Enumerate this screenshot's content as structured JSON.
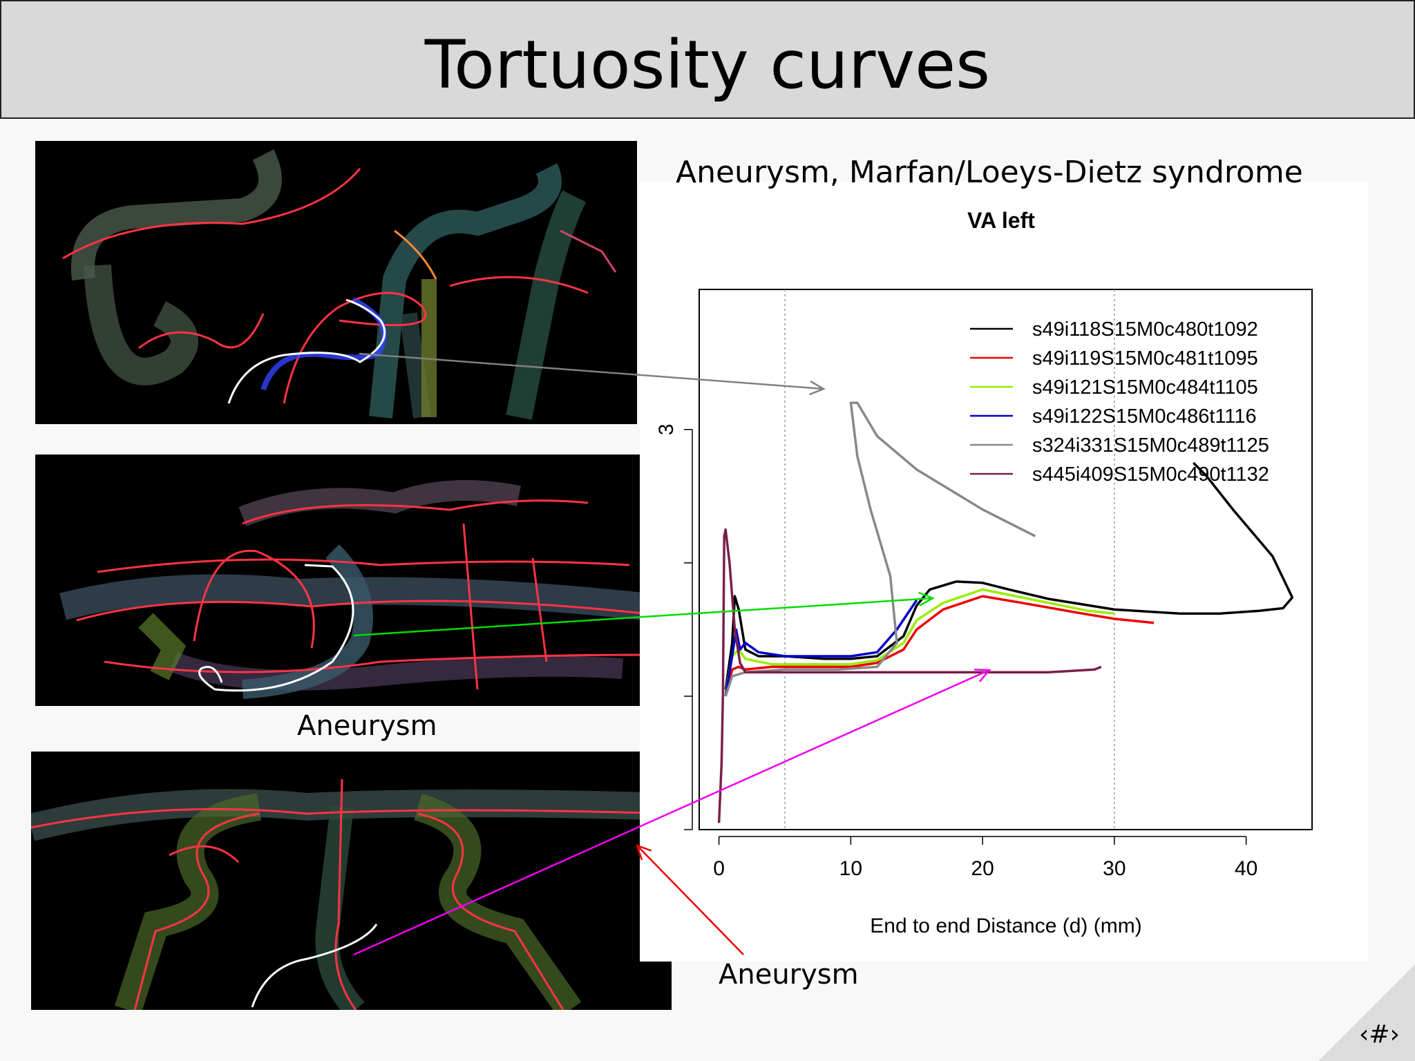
{
  "slide": {
    "title": "Tortuosity curves",
    "subtitle": "Aneurysm, Marfan/Loeys-Dietz syndrome",
    "label_aneurysm_mid": "Aneurysm",
    "label_aneurysm_bottom": "Aneurysm",
    "slide_number": "‹#›"
  },
  "colors": {
    "title_bar": "#d9d9d9",
    "arrow_gray": "#808080",
    "arrow_green": "#00dd00",
    "arrow_magenta": "#ee00ee",
    "arrow_red": "#ee0000"
  },
  "images": [
    {
      "name": "vessel-image-top",
      "content": "vessel-tree-rendering"
    },
    {
      "name": "vessel-image-middle",
      "content": "vessel-tree-rendering"
    },
    {
      "name": "vessel-image-bottom",
      "content": "vessel-tree-rendering"
    }
  ],
  "chart_data": {
    "type": "line",
    "title": "VA left",
    "xlabel": "End to end Distance (d) (mm)",
    "ylabel": "",
    "xlim": [
      -1.5,
      45
    ],
    "ylim": [
      0.0,
      4.05
    ],
    "x_ticks": [
      0,
      10,
      20,
      30,
      40
    ],
    "x_tick_labels": [
      "0",
      "10",
      "20",
      "30",
      "40"
    ],
    "y_ticks": [
      0,
      1,
      2,
      3
    ],
    "y_tick_labels": [
      "",
      "",
      "",
      "3"
    ],
    "vertical_grid": [
      5,
      30
    ],
    "legend_position": "top-right",
    "series": [
      {
        "name": "s49i118S15M0c480t1092",
        "color": "#000000",
        "points": [
          [
            0.5,
            1.05
          ],
          [
            1.0,
            1.4
          ],
          [
            1.2,
            1.75
          ],
          [
            1.5,
            1.65
          ],
          [
            2,
            1.35
          ],
          [
            3,
            1.3
          ],
          [
            5,
            1.3
          ],
          [
            8,
            1.28
          ],
          [
            10,
            1.28
          ],
          [
            12,
            1.3
          ],
          [
            14,
            1.45
          ],
          [
            15,
            1.68
          ],
          [
            16,
            1.8
          ],
          [
            18,
            1.86
          ],
          [
            20,
            1.85
          ],
          [
            22,
            1.8
          ],
          [
            25,
            1.73
          ],
          [
            30,
            1.65
          ],
          [
            35,
            1.62
          ],
          [
            38,
            1.62
          ],
          [
            41,
            1.64
          ],
          [
            42.8,
            1.66
          ],
          [
            43.5,
            1.74
          ],
          [
            42,
            2.05
          ],
          [
            39,
            2.4
          ],
          [
            37,
            2.65
          ],
          [
            36,
            2.75
          ]
        ]
      },
      {
        "name": "s49i119S15M0c481t1095",
        "color": "#ee0000",
        "points": [
          [
            0.5,
            1.0
          ],
          [
            1.0,
            1.2
          ],
          [
            1.5,
            1.22
          ],
          [
            2,
            1.2
          ],
          [
            4,
            1.22
          ],
          [
            8,
            1.22
          ],
          [
            10,
            1.22
          ],
          [
            12,
            1.25
          ],
          [
            14,
            1.35
          ],
          [
            15,
            1.5
          ],
          [
            17,
            1.65
          ],
          [
            20,
            1.75
          ],
          [
            23,
            1.7
          ],
          [
            27,
            1.63
          ],
          [
            30,
            1.58
          ],
          [
            33,
            1.55
          ]
        ]
      },
      {
        "name": "s49i121S15M0c484t1105",
        "color": "#99ee00",
        "points": [
          [
            0.5,
            1.02
          ],
          [
            1.0,
            1.3
          ],
          [
            1.5,
            1.35
          ],
          [
            2,
            1.28
          ],
          [
            4,
            1.24
          ],
          [
            8,
            1.24
          ],
          [
            10,
            1.24
          ],
          [
            12,
            1.27
          ],
          [
            14,
            1.4
          ],
          [
            15,
            1.57
          ],
          [
            17,
            1.7
          ],
          [
            20,
            1.8
          ],
          [
            24,
            1.72
          ],
          [
            28,
            1.64
          ],
          [
            30,
            1.62
          ]
        ]
      },
      {
        "name": "s49i122S15M0c486t1116",
        "color": "#0000cc",
        "points": [
          [
            0.5,
            1.0
          ],
          [
            1.0,
            1.3
          ],
          [
            1.3,
            1.5
          ],
          [
            1.6,
            1.35
          ],
          [
            2,
            1.4
          ],
          [
            3,
            1.33
          ],
          [
            5,
            1.3
          ],
          [
            8,
            1.3
          ],
          [
            10,
            1.3
          ],
          [
            12,
            1.33
          ],
          [
            13.5,
            1.5
          ],
          [
            15,
            1.72
          ]
        ]
      },
      {
        "name": "s324i331S15M0c489t1125",
        "color": "#888888",
        "points": [
          [
            0.5,
            1.0
          ],
          [
            1,
            1.15
          ],
          [
            2,
            1.18
          ],
          [
            5,
            1.2
          ],
          [
            9,
            1.2
          ],
          [
            12,
            1.22
          ],
          [
            13.5,
            1.4
          ],
          [
            13,
            1.9
          ],
          [
            11.5,
            2.4
          ],
          [
            10.5,
            2.8
          ],
          [
            10,
            3.2
          ],
          [
            10.5,
            3.2
          ],
          [
            12,
            2.95
          ],
          [
            15,
            2.7
          ],
          [
            20,
            2.4
          ],
          [
            24,
            2.2
          ]
        ]
      },
      {
        "name": "s445i409S15M0c490t1132",
        "color": "#7a1f4a",
        "points": [
          [
            0,
            0.05
          ],
          [
            0.2,
            0.5
          ],
          [
            0.3,
            1.0
          ],
          [
            0.4,
            2.2
          ],
          [
            0.5,
            2.25
          ],
          [
            0.8,
            2.0
          ],
          [
            1.2,
            1.5
          ],
          [
            1.6,
            1.25
          ],
          [
            2,
            1.18
          ],
          [
            5,
            1.18
          ],
          [
            10,
            1.18
          ],
          [
            20,
            1.18
          ],
          [
            25,
            1.18
          ],
          [
            28.5,
            1.2
          ],
          [
            29,
            1.22
          ]
        ]
      }
    ]
  }
}
